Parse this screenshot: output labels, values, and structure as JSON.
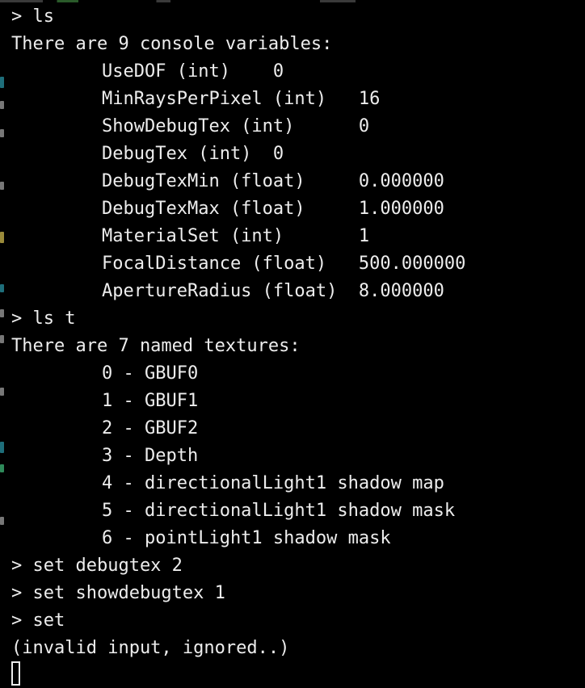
{
  "theme": {
    "background": "#000000",
    "foreground": "#ededed",
    "left_edge_colors": [
      "#1e6e7a",
      "#9a8a3a",
      "#1e6e7a",
      "#2e8a5a"
    ]
  },
  "terminal": {
    "lines": [
      "> ls",
      "There are 9 console variables:",
      "UseDOF (int)    0",
      "MinRaysPerPixel (int)   16",
      "ShowDebugTex (int)      0",
      "DebugTex (int)  0",
      "DebugTexMin (float)     0.000000",
      "DebugTexMax (float)     1.000000",
      "MaterialSet (int)       1",
      "FocalDistance (float)   500.000000",
      "ApertureRadius (float)  8.000000",
      "> ls t",
      "There are 7 named textures:",
      "0 - GBUF0",
      "1 - GBUF1",
      "2 - GBUF2",
      "3 - Depth",
      "4 - directionalLight1 shadow map",
      "5 - directionalLight1 shadow mask",
      "6 - pointLight1 shadow mask",
      "> set debugtex 2",
      "> set showdebugtex 1",
      "> set",
      "(invalid input, ignored..)"
    ]
  }
}
